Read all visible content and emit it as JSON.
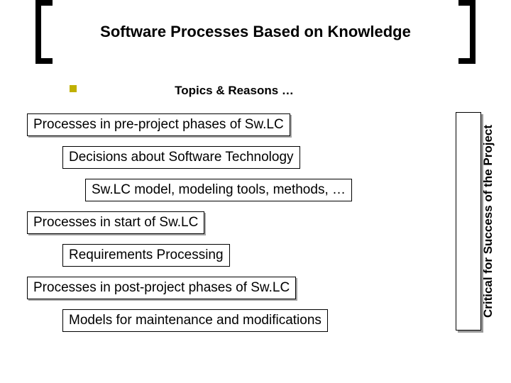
{
  "title": "Software Processes Based on Knowledge",
  "subtitle": "Topics & Reasons …",
  "items": {
    "pre_project": "Processes in pre-project phases of Sw.LC",
    "decisions": "Decisions about Software Technology",
    "swlc_model": "Sw.LC model, modeling tools, methods, …",
    "start": "Processes in start of Sw.LC",
    "requirements": "Requirements Processing",
    "post_project": "Processes in post-project phases of Sw.LC",
    "maintenance": "Models for maintenance and modifications"
  },
  "sidebar": "Critical for Success of the Project"
}
